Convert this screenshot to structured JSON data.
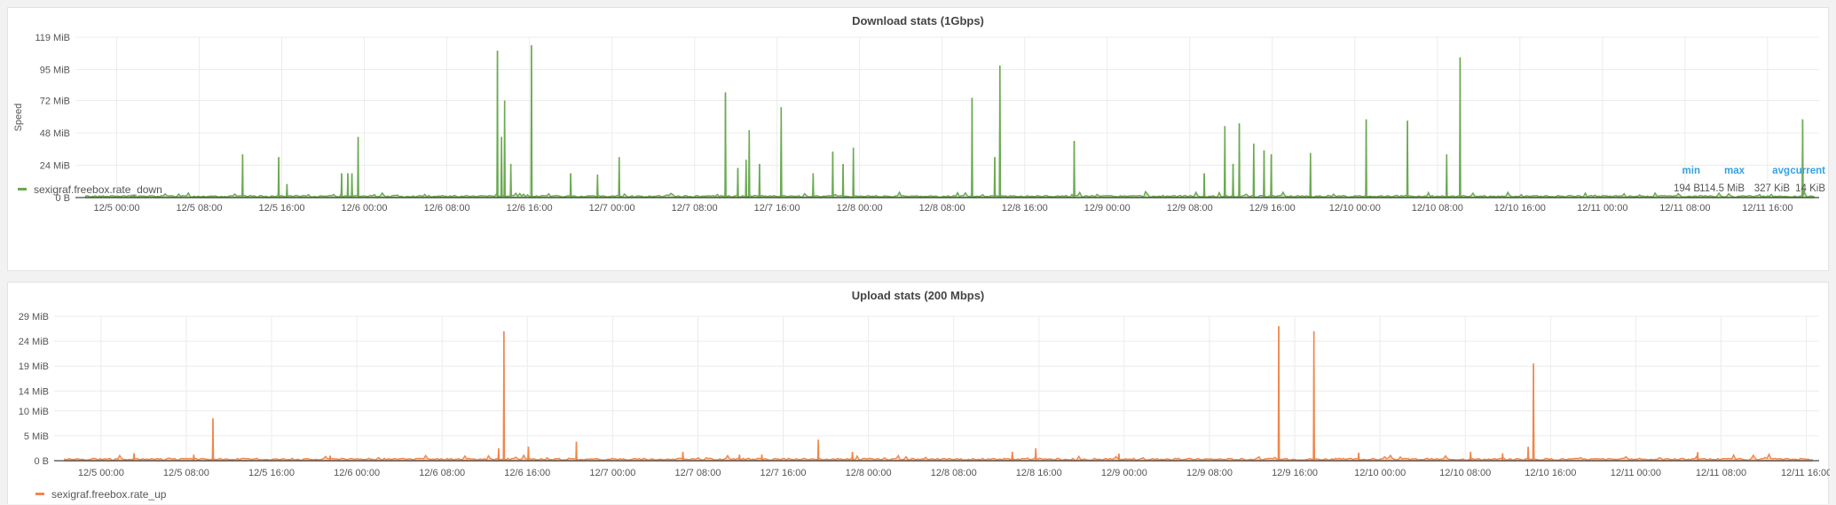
{
  "colors": {
    "download": "#6aaa50",
    "upload": "#f0874b",
    "stat_header": "#33a2e5",
    "grid": "#ececec"
  },
  "panels": [
    {
      "title": "Download stats (1Gbps)",
      "legend": {
        "label": "sexigraf.freebox.rate_down"
      },
      "stats_headers": {
        "min": "min",
        "max": "max",
        "avg": "avg",
        "current": "current"
      },
      "stats": {
        "min": "194 B",
        "max": "114.5 MiB",
        "avg": "327 KiB",
        "current": "14 KiB"
      }
    },
    {
      "title": "Upload stats (200 Mbps)",
      "legend": {
        "label": "sexigraf.freebox.rate_up"
      }
    }
  ],
  "chart_data": [
    {
      "type": "area",
      "title": "Download stats (1Gbps)",
      "ylabel": "Speed",
      "xlabel": "",
      "x_ticks": [
        "12/5 00:00",
        "12/5 08:00",
        "12/5 16:00",
        "12/6 00:00",
        "12/6 08:00",
        "12/6 16:00",
        "12/7 00:00",
        "12/7 08:00",
        "12/7 16:00",
        "12/8 00:00",
        "12/8 08:00",
        "12/8 16:00",
        "12/9 00:00",
        "12/9 08:00",
        "12/9 16:00",
        "12/10 00:00",
        "12/10 08:00",
        "12/10 16:00",
        "12/11 00:00",
        "12/11 08:00",
        "12/11 16:00"
      ],
      "y_ticks": [
        "0 B",
        "24 MiB",
        "48 MiB",
        "72 MiB",
        "95 MiB",
        "119 MiB"
      ],
      "y_tick_values": [
        0,
        24,
        48,
        72,
        95,
        119
      ],
      "ylim": [
        0,
        119
      ],
      "x_unit": "hours since 12/5 00:00",
      "xlim": [
        -4,
        165
      ],
      "grid": true,
      "legend_position": "bottom-left",
      "series": [
        {
          "name": "sexigraf.freebox.rate_down",
          "baseline_level": 1,
          "points": [
            [
              12.2,
              32
            ],
            [
              15.7,
              30
            ],
            [
              16.5,
              10
            ],
            [
              21.8,
              18
            ],
            [
              22.4,
              18
            ],
            [
              22.8,
              18
            ],
            [
              23.4,
              45
            ],
            [
              36.9,
              109
            ],
            [
              37.3,
              45
            ],
            [
              37.6,
              72
            ],
            [
              38.2,
              25
            ],
            [
              40.2,
              113
            ],
            [
              44,
              18
            ],
            [
              46.6,
              17
            ],
            [
              48.7,
              30
            ],
            [
              59,
              78
            ],
            [
              60.2,
              22
            ],
            [
              61,
              28
            ],
            [
              61.3,
              50
            ],
            [
              62.3,
              25
            ],
            [
              64.4,
              67
            ],
            [
              67.5,
              18
            ],
            [
              69.4,
              34
            ],
            [
              70.4,
              25
            ],
            [
              71.4,
              37
            ],
            [
              82.9,
              74
            ],
            [
              85.1,
              30
            ],
            [
              85.6,
              98
            ],
            [
              92.8,
              42
            ],
            [
              105.4,
              18
            ],
            [
              107.4,
              53
            ],
            [
              108.2,
              25
            ],
            [
              108.8,
              55
            ],
            [
              110.2,
              40
            ],
            [
              111.2,
              35
            ],
            [
              111.9,
              32
            ],
            [
              115.7,
              33
            ],
            [
              121.1,
              58
            ],
            [
              125.1,
              57
            ],
            [
              128.9,
              32
            ],
            [
              130.2,
              104
            ],
            [
              163.4,
              58
            ]
          ]
        }
      ]
    },
    {
      "type": "area",
      "title": "Upload stats (200 Mbps)",
      "ylabel": "",
      "xlabel": "",
      "x_ticks": [
        "12/5 00:00",
        "12/5 08:00",
        "12/5 16:00",
        "12/6 00:00",
        "12/6 08:00",
        "12/6 16:00",
        "12/7 00:00",
        "12/7 08:00",
        "12/7 16:00",
        "12/8 00:00",
        "12/8 08:00",
        "12/8 16:00",
        "12/9 00:00",
        "12/9 08:00",
        "12/9 16:00",
        "12/10 00:00",
        "12/10 08:00",
        "12/10 16:00",
        "12/11 00:00",
        "12/11 08:00",
        "12/11 16:00"
      ],
      "y_ticks": [
        "0 B",
        "5 MiB",
        "10 MiB",
        "14 MiB",
        "19 MiB",
        "24 MiB",
        "29 MiB"
      ],
      "y_tick_values": [
        0,
        5,
        10,
        14,
        19,
        24,
        29
      ],
      "ylim": [
        0,
        29
      ],
      "x_unit": "hours since 12/5 00:00",
      "xlim": [
        -4.4,
        161.2
      ],
      "grid": true,
      "legend_position": "bottom-left",
      "series": [
        {
          "name": "sexigraf.freebox.rate_up",
          "baseline_level": 0.3,
          "points": [
            [
              3.1,
              1.5
            ],
            [
              8.7,
              1.2
            ],
            [
              10.5,
              8.5
            ],
            [
              21.5,
              1
            ],
            [
              37.3,
              2.5
            ],
            [
              37.8,
              26
            ],
            [
              40.1,
              2.8
            ],
            [
              44.6,
              3.8
            ],
            [
              54.6,
              1.8
            ],
            [
              59.9,
              1.2
            ],
            [
              62,
              1.2
            ],
            [
              67.3,
              4.2
            ],
            [
              70.5,
              1.8
            ],
            [
              85.5,
              1.8
            ],
            [
              87.7,
              2.5
            ],
            [
              95.5,
              1.4
            ],
            [
              110.5,
              27
            ],
            [
              113.8,
              26
            ],
            [
              118,
              1.6
            ],
            [
              128.5,
              1.8
            ],
            [
              131.5,
              1.5
            ],
            [
              133.9,
              2.8
            ],
            [
              134.4,
              19.5
            ],
            [
              149.8,
              1.7
            ]
          ]
        }
      ]
    }
  ]
}
